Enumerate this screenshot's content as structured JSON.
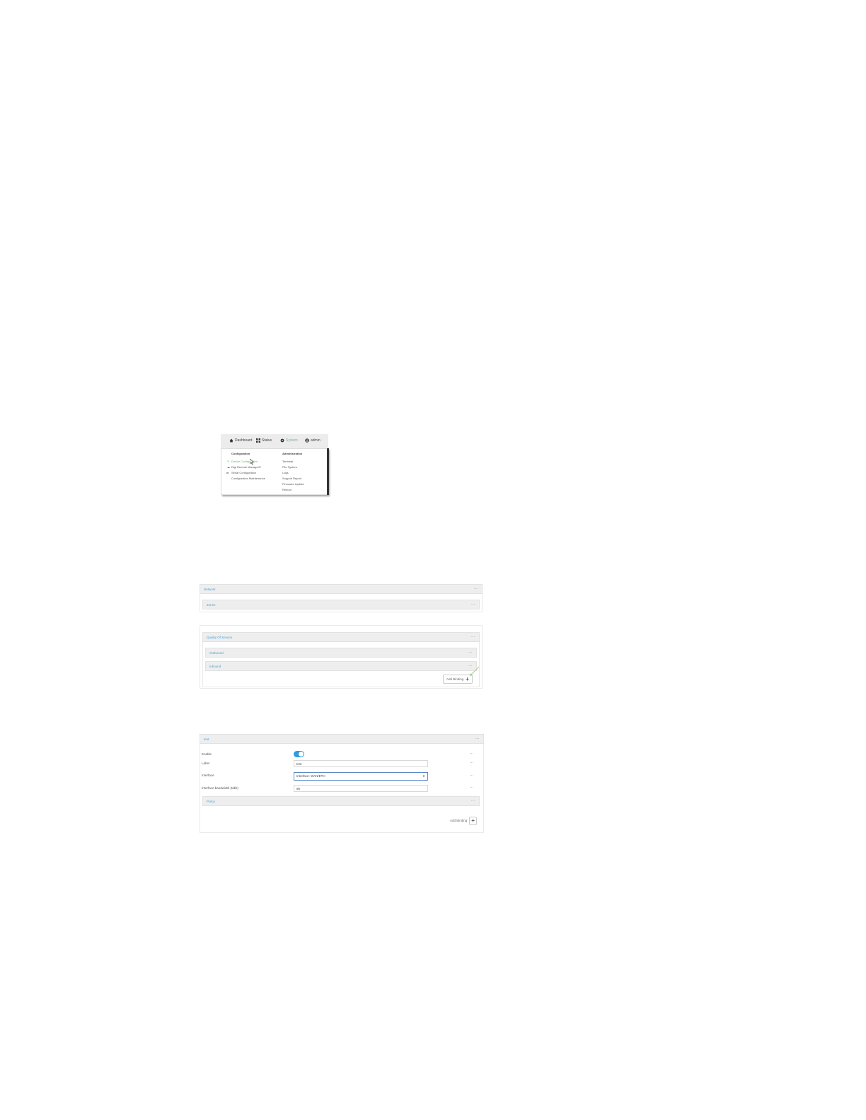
{
  "menu": {
    "nav": {
      "dashboard": "Dashboard",
      "status": "Status",
      "system": "System",
      "admin": "admin"
    },
    "configuration": {
      "heading": "Configuration",
      "items": [
        "Device Configuration",
        "Digi Remote Manager®",
        "Serial Configuration",
        "Configuration Maintenance"
      ]
    },
    "administration": {
      "heading": "Administration",
      "items": [
        "Terminal",
        "File System",
        "Logs",
        "Support Report",
        "Firmware Update",
        "Reboot"
      ]
    },
    "icons": {
      "dashboard": "home-icon",
      "status": "grid-icon",
      "system": "gear-icon",
      "admin": "user-circle-icon",
      "device_configuration": "wrench-icon",
      "remote_manager": "cloud-icon",
      "serial_configuration": "serial-arrows-icon"
    },
    "highlight_color": "#6ab36e"
  },
  "qos": {
    "network_title": "Network",
    "zones_title": "Zones",
    "qos_title": "Quality Of Service",
    "outbound_title": "Outbound",
    "inbound_title": "Inbound",
    "add_binding_label": "Add Binding",
    "more": "···"
  },
  "binding": {
    "title": "test",
    "enable_label": "Enable",
    "enable_on": true,
    "label_label": "Label",
    "label_value": "test",
    "interface_label": "Interface",
    "interface_value": "Interface: WAN/ETH",
    "bandwidth_label": "Interface bandwidth (Mbit)",
    "bandwidth_value": "95",
    "policy_title": "Policy",
    "add_binding_label": "Add Binding",
    "more": "···"
  },
  "colors": {
    "accent_blue": "#4aa6d6",
    "toggle_on": "#2d9be0",
    "menu_active": "#7ab39a"
  }
}
